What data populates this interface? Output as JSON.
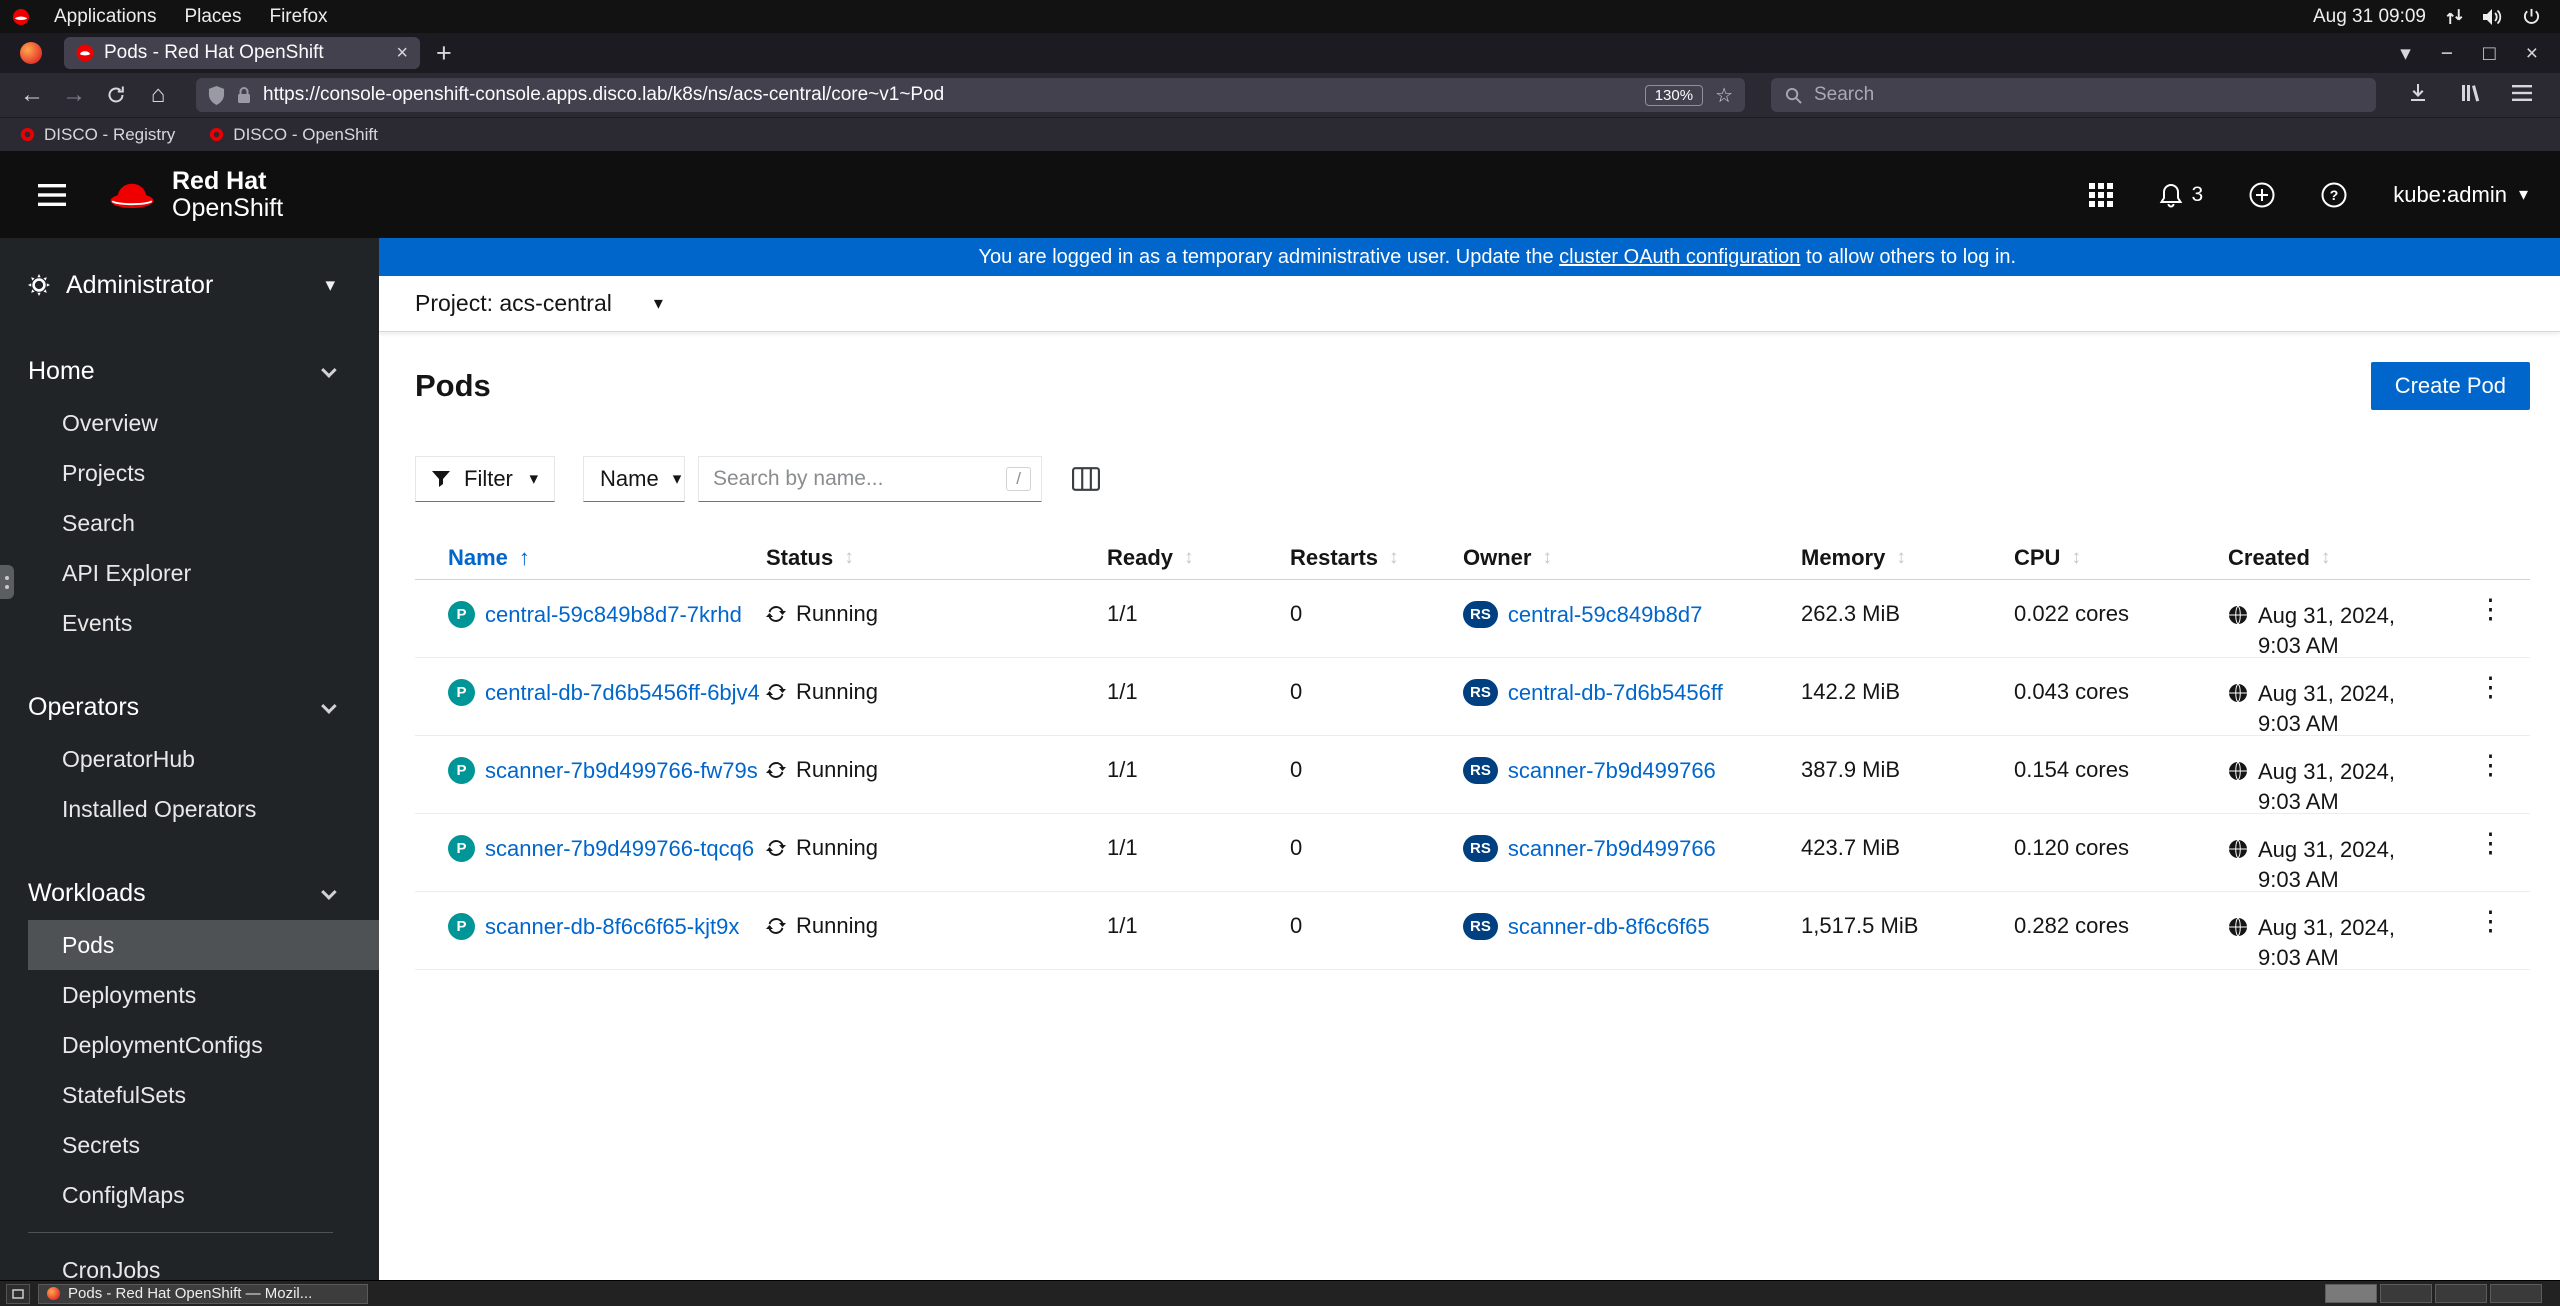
{
  "os": {
    "menus": [
      "Applications",
      "Places",
      "Firefox"
    ],
    "clock": "Aug 31 09:09"
  },
  "icons": {
    "caret_down": "▾",
    "sort_asc": "↑",
    "sort_both": "↕",
    "back": "←",
    "forward": "→",
    "home": "⌂",
    "star": "☆",
    "list_tabs": "▾",
    "minimize": "−",
    "maximize": "□",
    "close": "×",
    "tab_close": "×",
    "new_tab": "+",
    "kebab": "⋮"
  },
  "browser": {
    "tab_title": "Pods - Red Hat OpenShift",
    "url": "https://console-openshift-console.apps.disco.lab/k8s/ns/acs-central/core~v1~Pod",
    "zoom_level": "130%",
    "search_placeholder": "Search",
    "bookmarks": [
      "DISCO - Registry",
      "DISCO - OpenShift"
    ]
  },
  "masthead": {
    "brand_top": "Red Hat",
    "brand_bottom": "OpenShift",
    "notification_count": "3",
    "username": "kube:admin"
  },
  "banner": {
    "prefix": "You are logged in as a temporary administrative user. Update the ",
    "link_text": "cluster OAuth configuration",
    "suffix": " to allow others to log in."
  },
  "sidebar": {
    "perspective": "Administrator",
    "active_item": "Pods",
    "sections": [
      {
        "title": "Home",
        "items": [
          "Overview",
          "Projects",
          "Search",
          "API Explorer",
          "Events"
        ]
      },
      {
        "title": "Operators",
        "items": [
          "OperatorHub",
          "Installed Operators"
        ]
      },
      {
        "title": "Workloads",
        "items": [
          "Pods",
          "Deployments",
          "DeploymentConfigs",
          "StatefulSets",
          "Secrets",
          "ConfigMaps",
          "CronJobs"
        ]
      }
    ]
  },
  "project_bar": {
    "label": "Project: acs-central"
  },
  "page": {
    "title": "Pods",
    "create_button": "Create Pod",
    "filter_label": "Filter",
    "attribute_label": "Name",
    "search_placeholder": "Search by name...",
    "shortcut_key": "/"
  },
  "table": {
    "headers": [
      "Name",
      "Status",
      "Ready",
      "Restarts",
      "Owner",
      "Memory",
      "CPU",
      "Created"
    ],
    "badges": {
      "pod": "P",
      "owner": "RS"
    },
    "rows": [
      {
        "name": "central-59c849b8d7-7krhd",
        "status": "Running",
        "ready": "1/1",
        "restarts": "0",
        "owner": "central-59c849b8d7",
        "memory": "262.3 MiB",
        "cpu": "0.022 cores",
        "created": "Aug 31, 2024, 9:03 AM"
      },
      {
        "name": "central-db-7d6b5456ff-6bjv4",
        "status": "Running",
        "ready": "1/1",
        "restarts": "0",
        "owner": "central-db-7d6b5456ff",
        "memory": "142.2 MiB",
        "cpu": "0.043 cores",
        "created": "Aug 31, 2024, 9:03 AM"
      },
      {
        "name": "scanner-7b9d499766-fw79s",
        "status": "Running",
        "ready": "1/1",
        "restarts": "0",
        "owner": "scanner-7b9d499766",
        "memory": "387.9 MiB",
        "cpu": "0.154 cores",
        "created": "Aug 31, 2024, 9:03 AM"
      },
      {
        "name": "scanner-7b9d499766-tqcq6",
        "status": "Running",
        "ready": "1/1",
        "restarts": "0",
        "owner": "scanner-7b9d499766",
        "memory": "423.7 MiB",
        "cpu": "0.120 cores",
        "created": "Aug 31, 2024, 9:03 AM"
      },
      {
        "name": "scanner-db-8f6c6f65-kjt9x",
        "status": "Running",
        "ready": "1/1",
        "restarts": "0",
        "owner": "scanner-db-8f6c6f65",
        "memory": "1,517.5 MiB",
        "cpu": "0.282 cores",
        "created": "Aug 31, 2024, 9:03 AM"
      }
    ]
  },
  "taskbar": {
    "window_title": "Pods - Red Hat OpenShift — Mozil...",
    "workspace_count": 4
  },
  "colors": {
    "accent": "#0066cc",
    "banner_bg": "#0066cc",
    "pod_badge_bg": "#009596",
    "owner_badge_bg": "#004080",
    "masthead_bg": "#0f0f0f",
    "sidebar_bg": "#212427"
  }
}
